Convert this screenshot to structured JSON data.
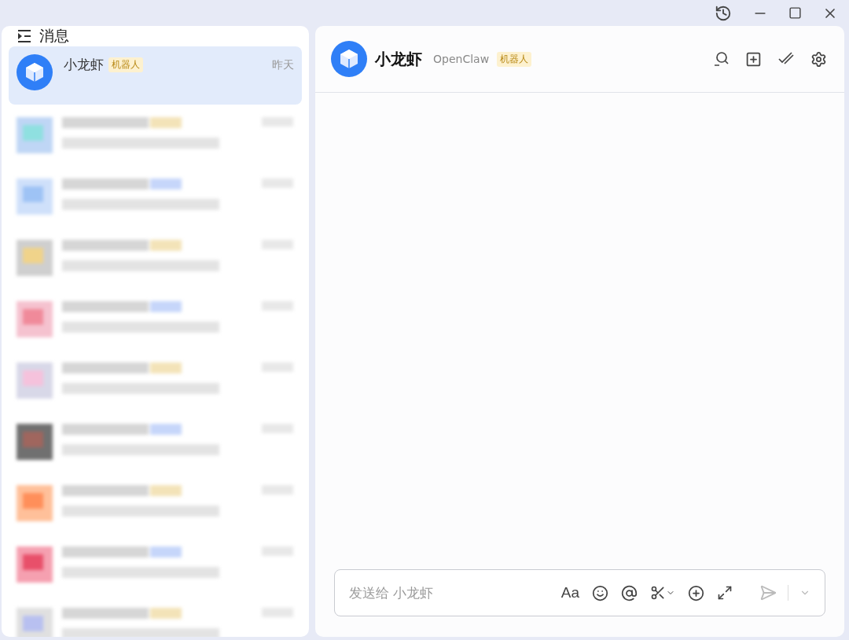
{
  "sidebar": {
    "title": "消息",
    "conversations": [
      {
        "kind": "chat",
        "name": "小龙虾",
        "tag": "机器人",
        "time": "昨天",
        "selected": true
      },
      {
        "kind": "redacted"
      },
      {
        "kind": "redacted"
      },
      {
        "kind": "redacted"
      },
      {
        "kind": "redacted"
      },
      {
        "kind": "redacted"
      },
      {
        "kind": "redacted"
      },
      {
        "kind": "redacted"
      },
      {
        "kind": "redacted"
      },
      {
        "kind": "redacted"
      }
    ]
  },
  "chat": {
    "name": "小龙虾",
    "subtitle": "OpenClaw",
    "tag": "机器人"
  },
  "composer": {
    "placeholder": "发送给 小龙虾",
    "format_label": "Aa"
  }
}
